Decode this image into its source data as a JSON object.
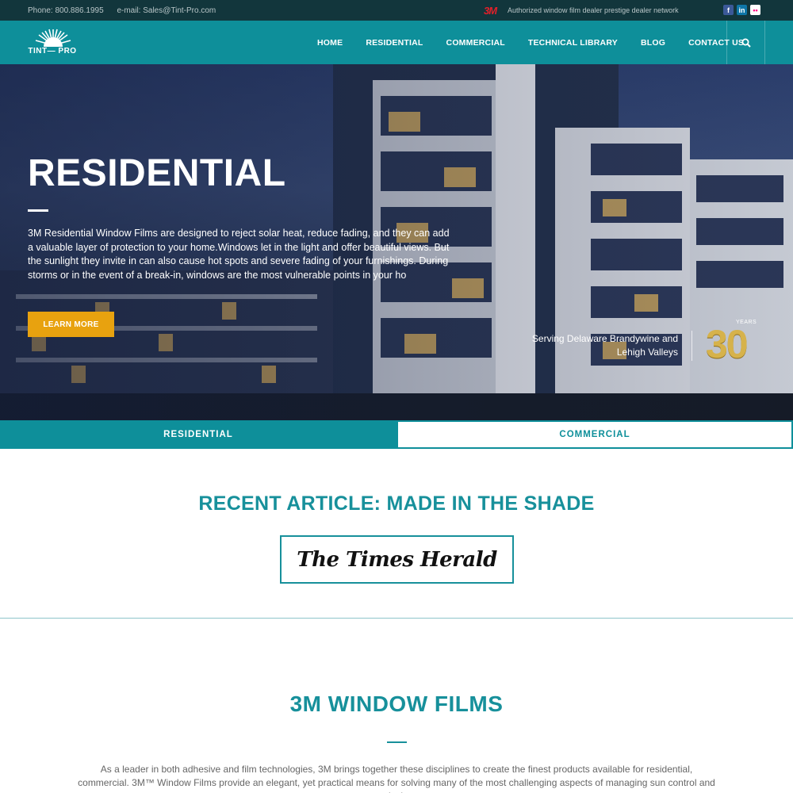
{
  "topbar": {
    "phone": "Phone: 800.886.1995",
    "email": "e-mail: Sales@Tint-Pro.com",
    "mmm_logo": "3M",
    "tagline": "Authorized window film dealer prestige dealer network",
    "social": [
      {
        "icon": "facebook-icon",
        "glyph": "f"
      },
      {
        "icon": "linkedin-icon",
        "glyph": "in"
      },
      {
        "icon": "flickr-icon",
        "glyph": "••"
      }
    ]
  },
  "nav": {
    "logo_text": "TINT— PRO",
    "items": [
      "HOME",
      "RESIDENTIAL",
      "COMMERCIAL",
      "TECHNICAL LIBRARY",
      "BLOG",
      "CONTACT US"
    ],
    "search_icon": "search-icon"
  },
  "hero": {
    "title": "RESIDENTIAL",
    "description": "3M Residential Window Films are designed to reject solar heat, reduce fading, and they can add a valuable layer of protection to your home.Windows let in the light and offer beautiful views. But the sunlight they invite in can also cause hot spots and severe fading of your furnishings. During storms or in the event of a break-in, windows are the most vulnerable points in your ho",
    "button": "LEARN MORE",
    "serving": "Serving Delaware Brandywine and Lehigh Valleys",
    "years_label": "YEARS",
    "years_number": "30"
  },
  "tabs": {
    "residential": "RESIDENTIAL",
    "commercial": "COMMERCIAL"
  },
  "article": {
    "title": "RECENT ARTICLE: MADE IN THE SHADE",
    "publication": "The Times Herald"
  },
  "films": {
    "title": "3M WINDOW FILMS",
    "text": "As a leader in both adhesive and film technologies, 3M brings together these disciplines to create the finest products available for residential, commercial. 3M™ Window Films provide an elegant, yet practical means for solving many of the most challenging aspects of managing sun control and security issues"
  },
  "colors": {
    "teal": "#0e8f9a",
    "dark_top": "#12363c",
    "orange": "#e8a20f",
    "gold": "#d6b24b"
  }
}
